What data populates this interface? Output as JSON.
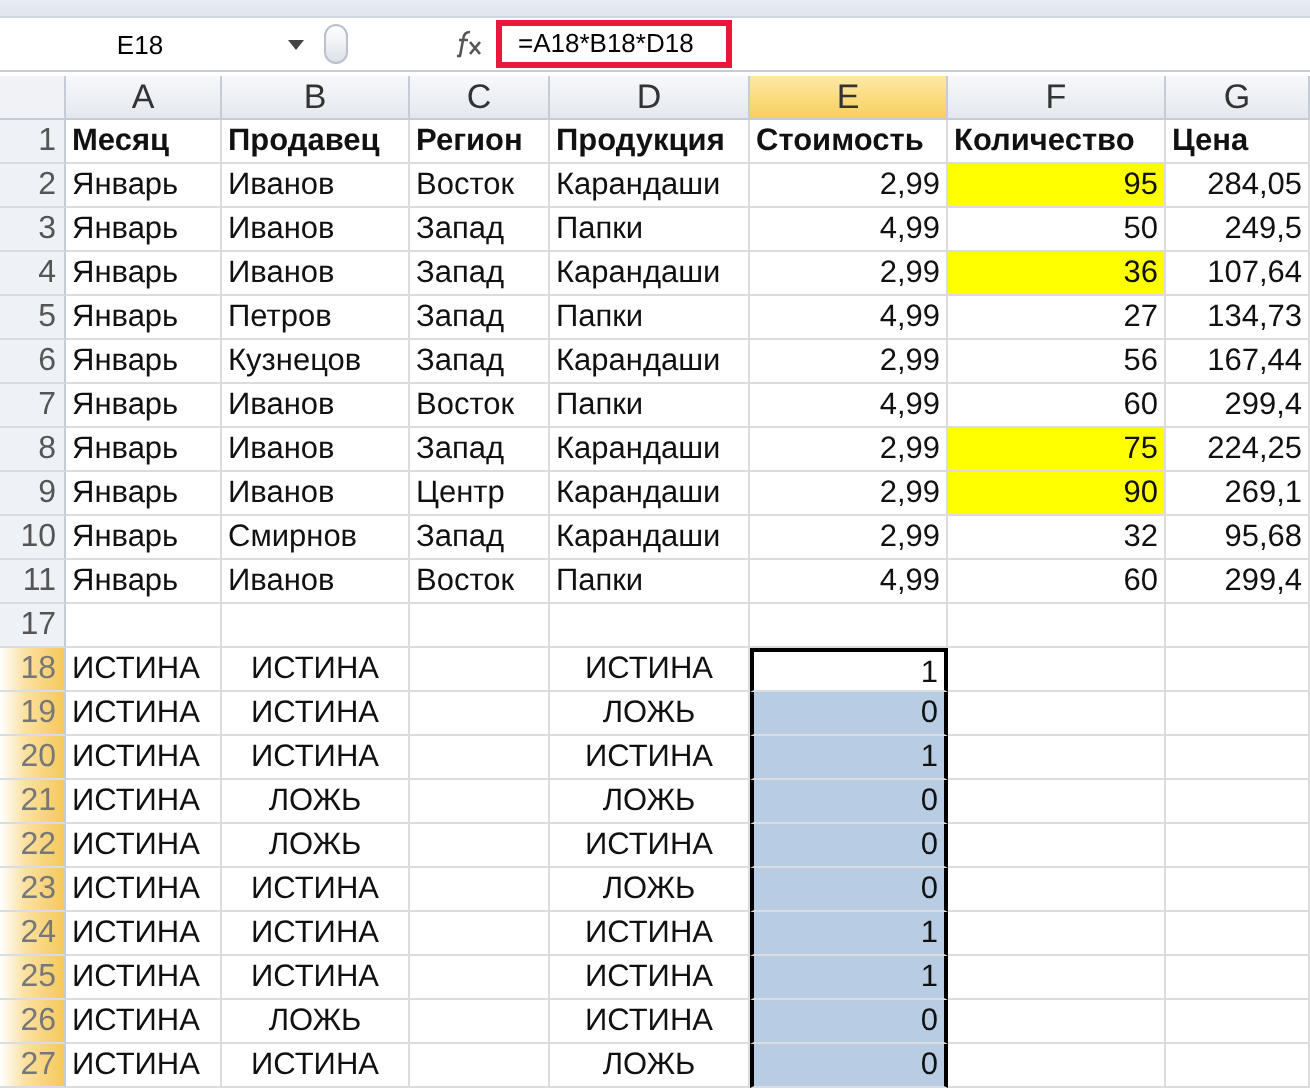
{
  "name_box": "E18",
  "formula": "=A18*B18*D18",
  "columns": [
    {
      "label": "A",
      "selected": false
    },
    {
      "label": "B",
      "selected": false
    },
    {
      "label": "C",
      "selected": false
    },
    {
      "label": "D",
      "selected": false
    },
    {
      "label": "E",
      "selected": true
    },
    {
      "label": "F",
      "selected": false
    },
    {
      "label": "G",
      "selected": false
    }
  ],
  "rows": [
    {
      "number": "1",
      "selected": false,
      "cells": [
        {
          "text": "Месяц",
          "kind": "header"
        },
        {
          "text": "Продавец",
          "kind": "header"
        },
        {
          "text": "Регион",
          "kind": "header"
        },
        {
          "text": "Продукция",
          "kind": "header"
        },
        {
          "text": "Стоимость",
          "kind": "header"
        },
        {
          "text": "Количество",
          "kind": "header"
        },
        {
          "text": "Цена",
          "kind": "header"
        }
      ]
    },
    {
      "number": "2",
      "selected": false,
      "cells": [
        {
          "text": "Январь",
          "kind": "text"
        },
        {
          "text": "Иванов",
          "kind": "text"
        },
        {
          "text": "Восток",
          "kind": "text"
        },
        {
          "text": "Карандаши",
          "kind": "text"
        },
        {
          "text": "2,99",
          "kind": "number"
        },
        {
          "text": "95",
          "kind": "number",
          "color": "#ffff00"
        },
        {
          "text": "284,05",
          "kind": "number"
        }
      ]
    },
    {
      "number": "3",
      "selected": false,
      "cells": [
        {
          "text": "Январь",
          "kind": "text"
        },
        {
          "text": "Иванов",
          "kind": "text"
        },
        {
          "text": "Запад",
          "kind": "text"
        },
        {
          "text": "Папки",
          "kind": "text"
        },
        {
          "text": "4,99",
          "kind": "number"
        },
        {
          "text": "50",
          "kind": "number"
        },
        {
          "text": "249,5",
          "kind": "number"
        }
      ]
    },
    {
      "number": "4",
      "selected": false,
      "cells": [
        {
          "text": "Январь",
          "kind": "text"
        },
        {
          "text": "Иванов",
          "kind": "text"
        },
        {
          "text": "Запад",
          "kind": "text"
        },
        {
          "text": "Карандаши",
          "kind": "text"
        },
        {
          "text": "2,99",
          "kind": "number"
        },
        {
          "text": "36",
          "kind": "number",
          "color": "#ffff00"
        },
        {
          "text": "107,64",
          "kind": "number"
        }
      ]
    },
    {
      "number": "5",
      "selected": false,
      "cells": [
        {
          "text": "Январь",
          "kind": "text"
        },
        {
          "text": "Петров",
          "kind": "text"
        },
        {
          "text": "Запад",
          "kind": "text"
        },
        {
          "text": "Папки",
          "kind": "text"
        },
        {
          "text": "4,99",
          "kind": "number"
        },
        {
          "text": "27",
          "kind": "number"
        },
        {
          "text": "134,73",
          "kind": "number"
        }
      ]
    },
    {
      "number": "6",
      "selected": false,
      "cells": [
        {
          "text": "Январь",
          "kind": "text"
        },
        {
          "text": "Кузнецов",
          "kind": "text"
        },
        {
          "text": "Запад",
          "kind": "text"
        },
        {
          "text": "Карандаши",
          "kind": "text"
        },
        {
          "text": "2,99",
          "kind": "number"
        },
        {
          "text": "56",
          "kind": "number"
        },
        {
          "text": "167,44",
          "kind": "number"
        }
      ]
    },
    {
      "number": "7",
      "selected": false,
      "cells": [
        {
          "text": "Январь",
          "kind": "text"
        },
        {
          "text": "Иванов",
          "kind": "text"
        },
        {
          "text": "Восток",
          "kind": "text"
        },
        {
          "text": "Папки",
          "kind": "text"
        },
        {
          "text": "4,99",
          "kind": "number"
        },
        {
          "text": "60",
          "kind": "number"
        },
        {
          "text": "299,4",
          "kind": "number"
        }
      ]
    },
    {
      "number": "8",
      "selected": false,
      "cells": [
        {
          "text": "Январь",
          "kind": "text"
        },
        {
          "text": "Иванов",
          "kind": "text"
        },
        {
          "text": "Запад",
          "kind": "text"
        },
        {
          "text": "Карандаши",
          "kind": "text"
        },
        {
          "text": "2,99",
          "kind": "number"
        },
        {
          "text": "75",
          "kind": "number",
          "color": "#ffff00"
        },
        {
          "text": "224,25",
          "kind": "number"
        }
      ]
    },
    {
      "number": "9",
      "selected": false,
      "cells": [
        {
          "text": "Январь",
          "kind": "text"
        },
        {
          "text": "Иванов",
          "kind": "text"
        },
        {
          "text": "Центр",
          "kind": "text"
        },
        {
          "text": "Карандаши",
          "kind": "text"
        },
        {
          "text": "2,99",
          "kind": "number"
        },
        {
          "text": "90",
          "kind": "number",
          "color": "#ffff00"
        },
        {
          "text": "269,1",
          "kind": "number"
        }
      ]
    },
    {
      "number": "10",
      "selected": false,
      "cells": [
        {
          "text": "Январь",
          "kind": "text"
        },
        {
          "text": "Смирнов",
          "kind": "text"
        },
        {
          "text": "Запад",
          "kind": "text"
        },
        {
          "text": "Карандаши",
          "kind": "text"
        },
        {
          "text": "2,99",
          "kind": "number"
        },
        {
          "text": "32",
          "kind": "number"
        },
        {
          "text": "95,68",
          "kind": "number"
        }
      ]
    },
    {
      "number": "11",
      "selected": false,
      "cells": [
        {
          "text": "Январь",
          "kind": "text"
        },
        {
          "text": "Иванов",
          "kind": "text"
        },
        {
          "text": "Восток",
          "kind": "text"
        },
        {
          "text": "Папки",
          "kind": "text"
        },
        {
          "text": "4,99",
          "kind": "number"
        },
        {
          "text": "60",
          "kind": "number"
        },
        {
          "text": "299,4",
          "kind": "number"
        }
      ]
    },
    {
      "number": "17",
      "selected": false,
      "cells": [
        {},
        {},
        {},
        {},
        {},
        {},
        {}
      ]
    },
    {
      "number": "18",
      "selected": true,
      "cells": [
        {
          "text": "ИСТИНА",
          "kind": "text"
        },
        {
          "text": "ИСТИНА",
          "kind": "centered"
        },
        {},
        {
          "text": "ИСТИНА",
          "kind": "centered"
        },
        {
          "text": "1",
          "kind": "number",
          "active": true
        },
        {},
        {}
      ]
    },
    {
      "number": "19",
      "selected": true,
      "cells": [
        {
          "text": "ИСТИНА",
          "kind": "text"
        },
        {
          "text": "ИСТИНА",
          "kind": "centered"
        },
        {},
        {
          "text": "ЛОЖЬ",
          "kind": "centered"
        },
        {
          "text": "0",
          "kind": "number"
        },
        {},
        {}
      ]
    },
    {
      "number": "20",
      "selected": true,
      "cells": [
        {
          "text": "ИСТИНА",
          "kind": "text"
        },
        {
          "text": "ИСТИНА",
          "kind": "centered"
        },
        {},
        {
          "text": "ИСТИНА",
          "kind": "centered"
        },
        {
          "text": "1",
          "kind": "number"
        },
        {},
        {}
      ]
    },
    {
      "number": "21",
      "selected": true,
      "cells": [
        {
          "text": "ИСТИНА",
          "kind": "text"
        },
        {
          "text": "ЛОЖЬ",
          "kind": "centered"
        },
        {},
        {
          "text": "ЛОЖЬ",
          "kind": "centered"
        },
        {
          "text": "0",
          "kind": "number"
        },
        {},
        {}
      ]
    },
    {
      "number": "22",
      "selected": true,
      "cells": [
        {
          "text": "ИСТИНА",
          "kind": "text"
        },
        {
          "text": "ЛОЖЬ",
          "kind": "centered"
        },
        {},
        {
          "text": "ИСТИНА",
          "kind": "centered"
        },
        {
          "text": "0",
          "kind": "number"
        },
        {},
        {}
      ]
    },
    {
      "number": "23",
      "selected": true,
      "cells": [
        {
          "text": "ИСТИНА",
          "kind": "text"
        },
        {
          "text": "ИСТИНА",
          "kind": "centered"
        },
        {},
        {
          "text": "ЛОЖЬ",
          "kind": "centered"
        },
        {
          "text": "0",
          "kind": "number"
        },
        {},
        {}
      ]
    },
    {
      "number": "24",
      "selected": true,
      "cells": [
        {
          "text": "ИСТИНА",
          "kind": "text"
        },
        {
          "text": "ИСТИНА",
          "kind": "centered"
        },
        {},
        {
          "text": "ИСТИНА",
          "kind": "centered"
        },
        {
          "text": "1",
          "kind": "number"
        },
        {},
        {}
      ]
    },
    {
      "number": "25",
      "selected": true,
      "cells": [
        {
          "text": "ИСТИНА",
          "kind": "text"
        },
        {
          "text": "ИСТИНА",
          "kind": "centered"
        },
        {},
        {
          "text": "ИСТИНА",
          "kind": "centered"
        },
        {
          "text": "1",
          "kind": "number"
        },
        {},
        {}
      ]
    },
    {
      "number": "26",
      "selected": true,
      "cells": [
        {
          "text": "ИСТИНА",
          "kind": "text"
        },
        {
          "text": "ЛОЖЬ",
          "kind": "centered"
        },
        {},
        {
          "text": "ИСТИНА",
          "kind": "centered"
        },
        {
          "text": "0",
          "kind": "number"
        },
        {},
        {}
      ]
    },
    {
      "number": "27",
      "selected": true,
      "cells": [
        {
          "text": "ИСТИНА",
          "kind": "text"
        },
        {
          "text": "ИСТИНА",
          "kind": "centered"
        },
        {},
        {
          "text": "ЛОЖЬ",
          "kind": "centered"
        },
        {
          "text": "0",
          "kind": "number"
        },
        {},
        {}
      ]
    }
  ]
}
